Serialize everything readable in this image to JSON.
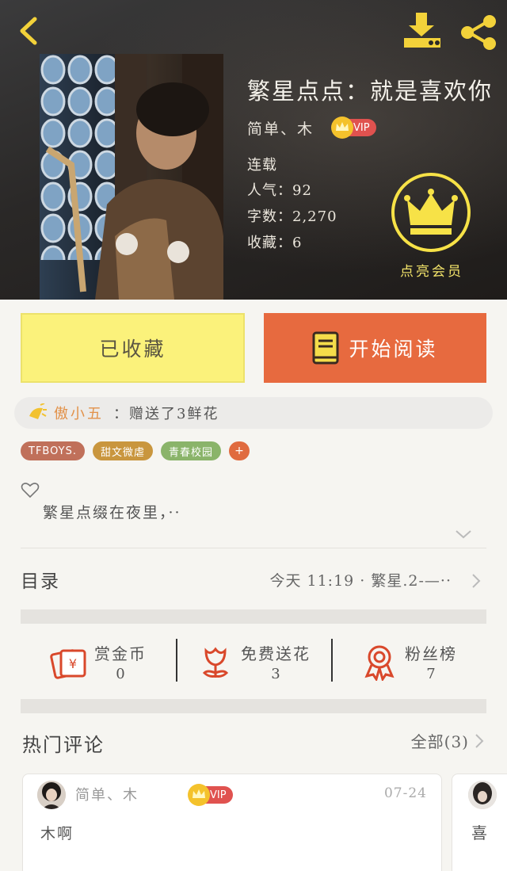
{
  "header": {
    "title": "繁星点点：就是喜欢你",
    "author": "简单、木",
    "vip_label": "VIP",
    "status": "连载",
    "popularity": "人气：92",
    "word_count": "字数：2,270",
    "favorites": "收藏：6",
    "member_label": "点亮会员"
  },
  "actions": {
    "favorited_label": "已收藏",
    "read_label": "开始阅读"
  },
  "gift": {
    "giver": "傲小五",
    "text": "：赠送了3鲜花"
  },
  "tags": [
    {
      "label": "TFBOYS.",
      "color": "#c0705a"
    },
    {
      "label": "甜文微虐",
      "color": "#c9963e"
    },
    {
      "label": "青春校园",
      "color": "#8ab46a"
    }
  ],
  "tag_more": "+",
  "summary": "繁星点缀在夜里，··",
  "toc": {
    "label": "目录",
    "update": "今天 11:19 · 繁星.2-—··"
  },
  "stats": [
    {
      "label": "赏金币",
      "value": "0",
      "icon": "money-icon"
    },
    {
      "label": "免费送花",
      "value": "3",
      "icon": "flower-icon"
    },
    {
      "label": "粉丝榜",
      "value": "7",
      "icon": "medal-icon"
    }
  ],
  "comments": {
    "title": "热门评论",
    "see_all": "全部(3)",
    "items": [
      {
        "user": "简单、木",
        "vip_label": "VIP",
        "date": "07-24",
        "text": "木啊"
      },
      {
        "text": "喜"
      }
    ]
  },
  "colors": {
    "accent_orange": "#e76a3f",
    "favorite_yellow": "#fbf27b",
    "member_yellow": "#f7e247",
    "vip_red": "#e0524f"
  }
}
